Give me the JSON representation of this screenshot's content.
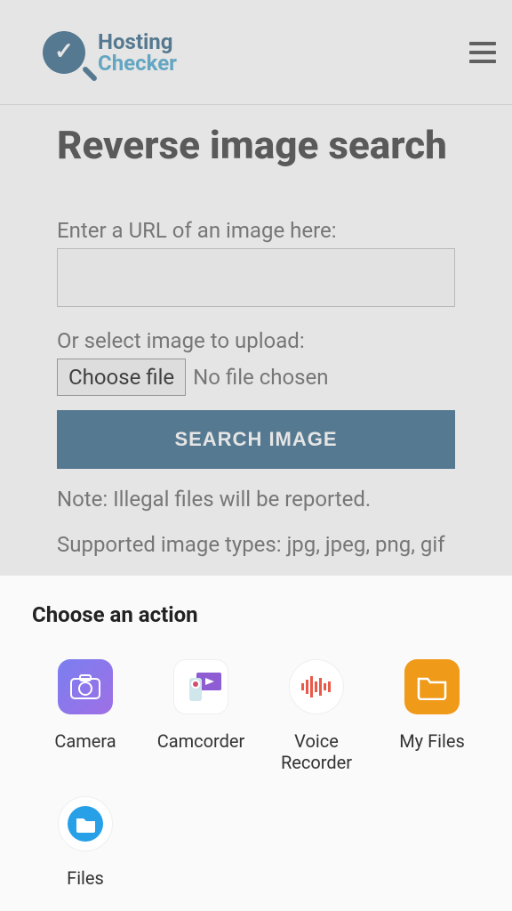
{
  "header": {
    "logo_line1": "Hosting",
    "logo_line2": "Checker"
  },
  "main": {
    "title": "Reverse image search",
    "url_label": "Enter a URL of an image here:",
    "url_value": "",
    "upload_label": "Or select image to upload:",
    "choose_file_label": "Choose file",
    "file_status": "No file chosen",
    "search_button": "SEARCH IMAGE",
    "note_line1": "Note: Illegal files will be reported.",
    "note_line2": "Supported image types: jpg, jpeg, png, gif"
  },
  "sheet": {
    "title": "Choose an action",
    "actions": [
      {
        "label": "Camera"
      },
      {
        "label": "Camcorder"
      },
      {
        "label": "Voice Recorder"
      },
      {
        "label": "My Files"
      },
      {
        "label": "Files"
      }
    ]
  }
}
